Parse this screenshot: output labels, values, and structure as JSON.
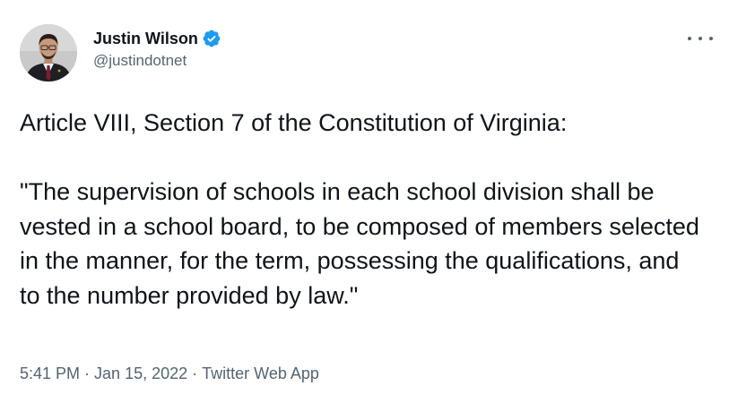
{
  "author": {
    "display_name": "Justin Wilson",
    "handle": "@justindotnet",
    "verified": true
  },
  "tweet": {
    "text": "Article VIII, Section 7 of the Constitution of Virginia:\n\n\"The supervision of schools in each school division shall be vested in a school board, to be composed of members selected in the manner, for the term, possessing the qualifications, and to the number provided by law.\""
  },
  "meta": {
    "time": "5:41 PM",
    "date": "Jan 15, 2022",
    "source": "Twitter Web App",
    "separator": "·"
  },
  "colors": {
    "verified_blue": "#1d9bf0",
    "secondary_text": "#536471",
    "primary_text": "#0f1419"
  },
  "icons": {
    "verified": "verified-badge-icon",
    "more": "more-dots-icon"
  }
}
